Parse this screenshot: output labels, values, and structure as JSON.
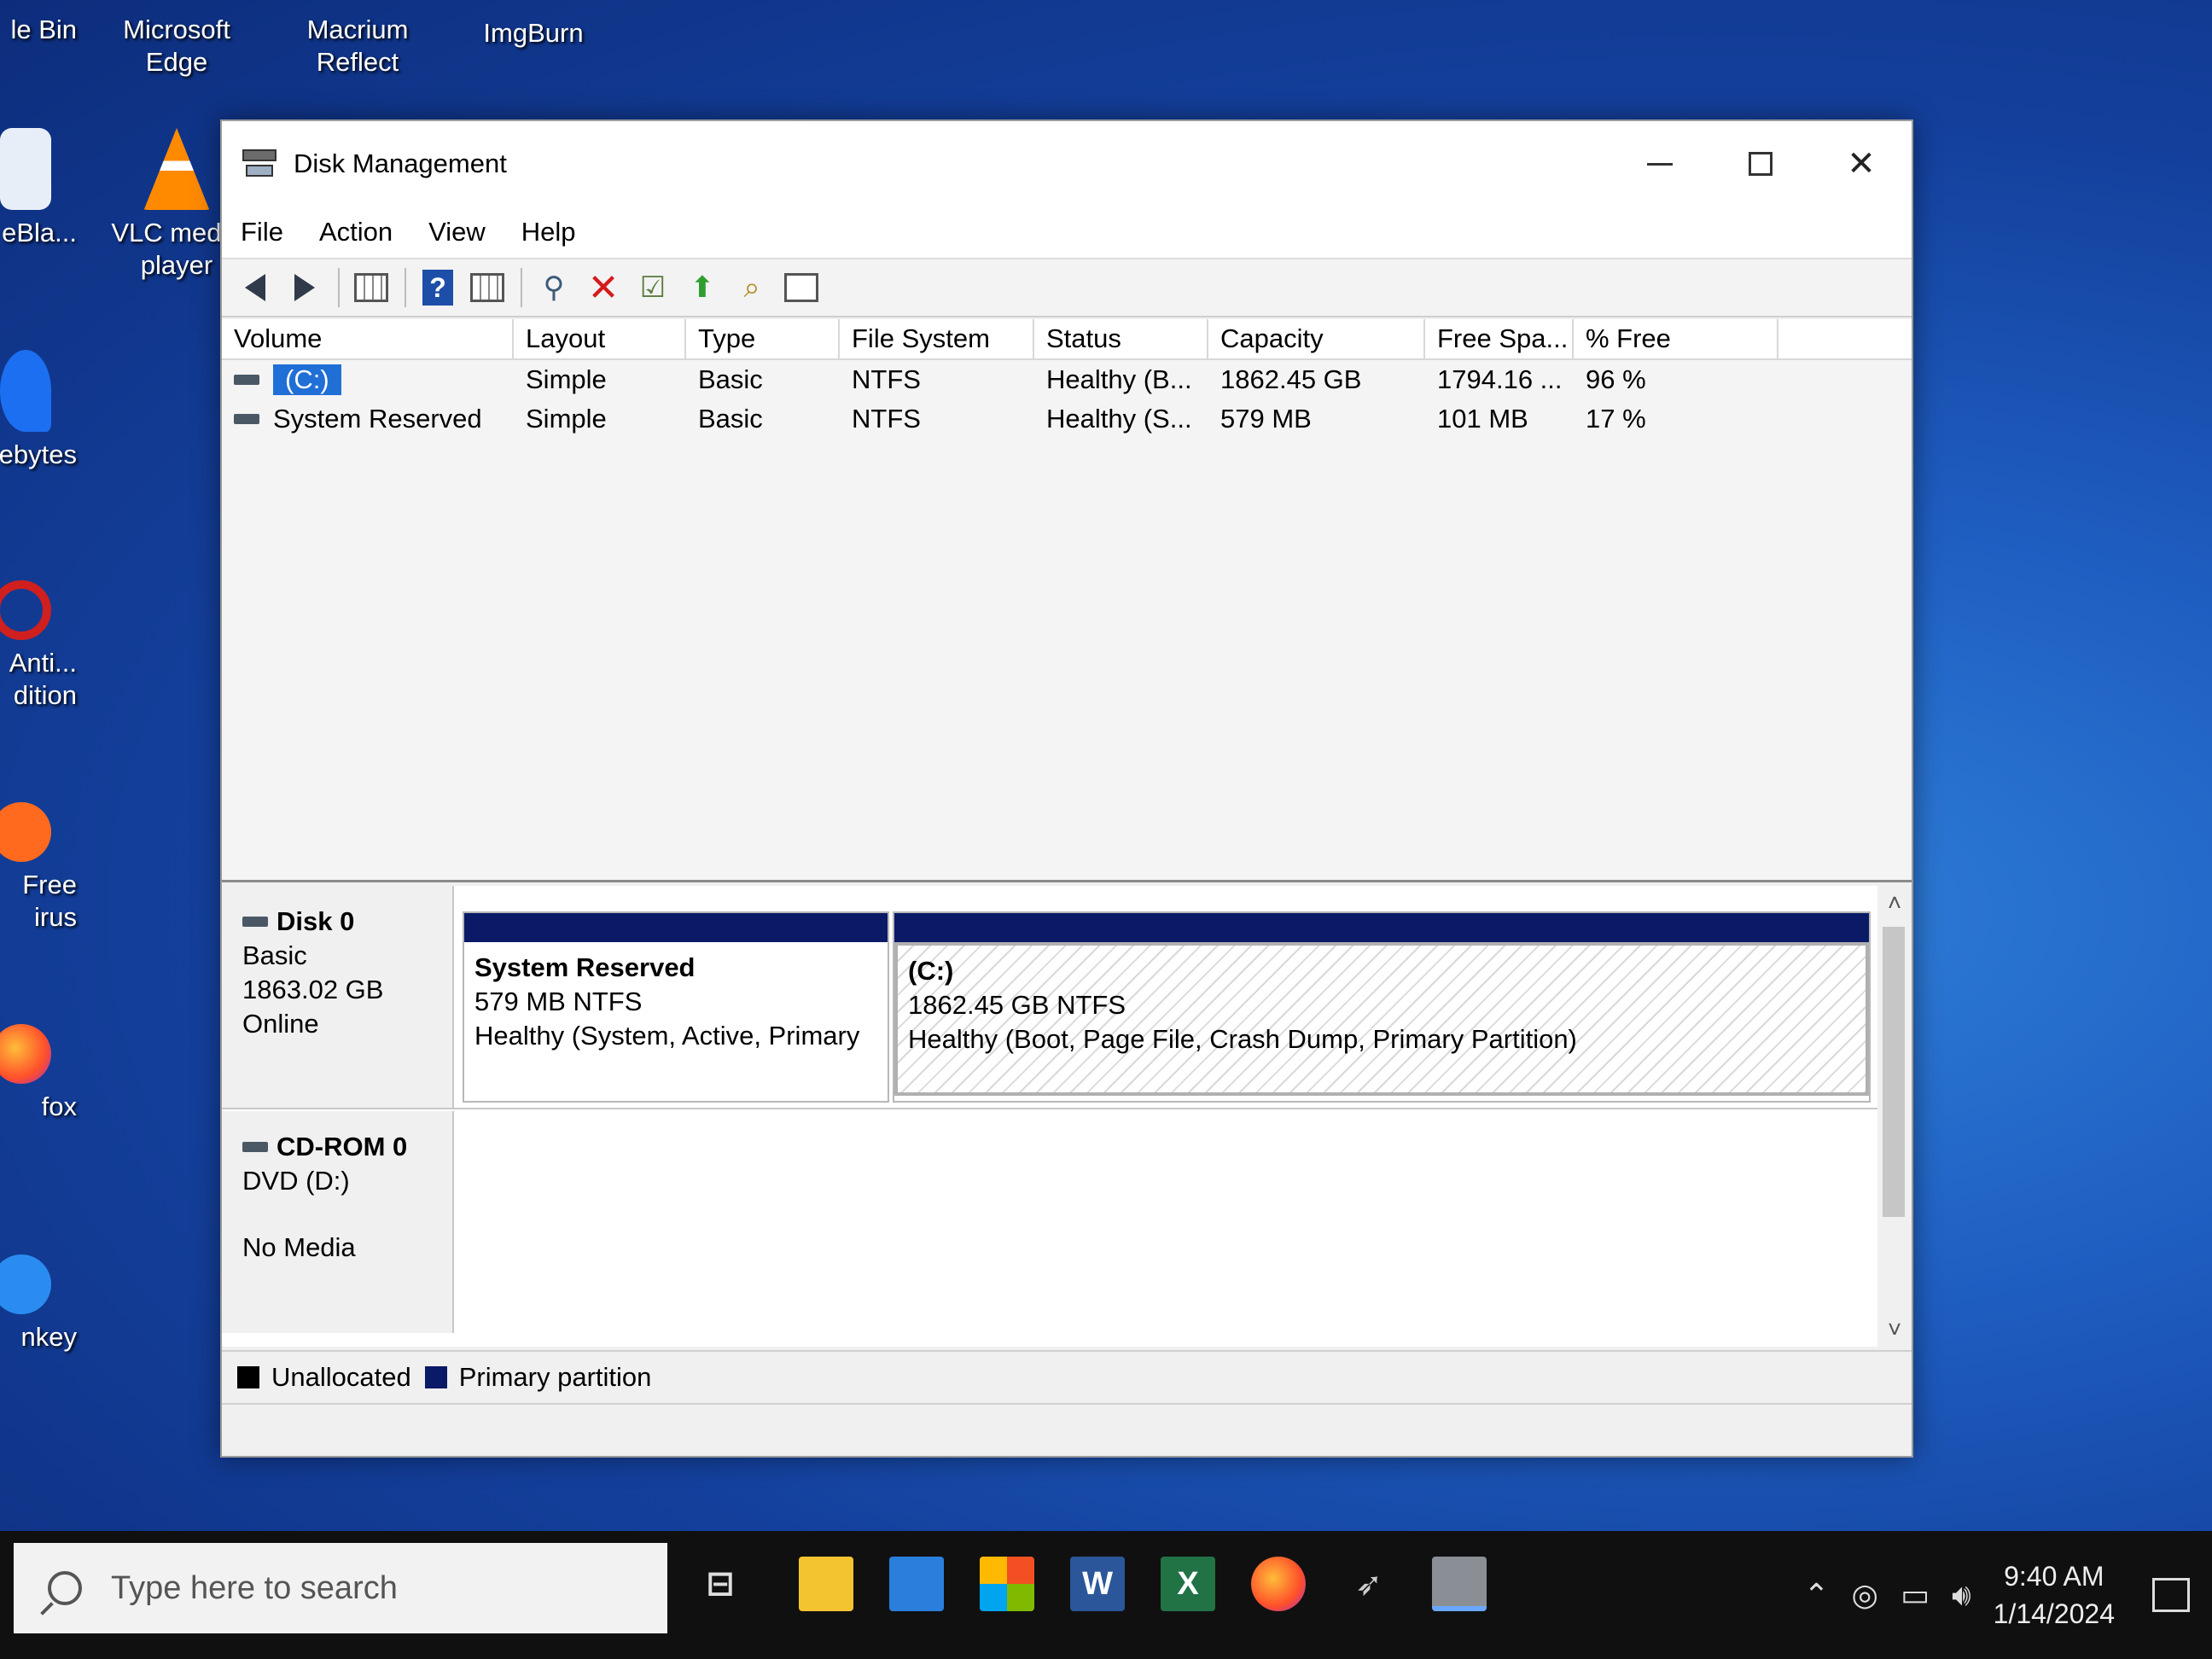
{
  "desktop": {
    "icons": [
      {
        "label": "le Bin"
      },
      {
        "label": "Microsoft Edge"
      },
      {
        "label": "Macrium Reflect"
      },
      {
        "label": "ImgBurn"
      },
      {
        "label": "eBla..."
      },
      {
        "label": "VLC media player"
      },
      {
        "label": "ebytes"
      },
      {
        "label": "Anti... dition"
      },
      {
        "label": "Free irus"
      },
      {
        "label": "fox"
      },
      {
        "label": "nkey"
      }
    ]
  },
  "window": {
    "title": "Disk Management",
    "controls": {
      "minimize": "–",
      "maximize": "☐",
      "close": "✕"
    }
  },
  "menu": [
    "File",
    "Action",
    "View",
    "Help"
  ],
  "toolbar": {
    "buttons": [
      "back-icon",
      "forward-icon",
      "console-tree-icon",
      "help-icon",
      "properties-icon",
      "connect-icon",
      "delete-icon",
      "check-icon",
      "up-icon",
      "search-icon",
      "view-icon"
    ]
  },
  "volumes": {
    "columns": [
      "Volume",
      "Layout",
      "Type",
      "File System",
      "Status",
      "Capacity",
      "Free Spa...",
      "% Free"
    ],
    "rows": [
      {
        "volume": "(C:)",
        "layout": "Simple",
        "type": "Basic",
        "fs": "NTFS",
        "status": "Healthy (B...",
        "capacity": "1862.45 GB",
        "free": "1794.16 ...",
        "pct": "96 %"
      },
      {
        "volume": "System Reserved",
        "layout": "Simple",
        "type": "Basic",
        "fs": "NTFS",
        "status": "Healthy (S...",
        "capacity": "579 MB",
        "free": "101 MB",
        "pct": "17 %"
      }
    ]
  },
  "disks": [
    {
      "name": "Disk 0",
      "type": "Basic",
      "size": "1863.02 GB",
      "state": "Online",
      "partitions": [
        {
          "title": "System Reserved",
          "size": "579 MB NTFS",
          "status": "Healthy (System, Active, Primary"
        },
        {
          "title": "(C:)",
          "size": "1862.45 GB NTFS",
          "status": "Healthy (Boot, Page File, Crash Dump, Primary Partition)"
        }
      ]
    },
    {
      "name": "CD-ROM 0",
      "type": "DVD (D:)",
      "state": "No Media"
    }
  ],
  "legend": [
    {
      "label": "Unallocated",
      "color": "#000000"
    },
    {
      "label": "Primary partition",
      "color": "#0a1a66"
    }
  ],
  "taskbar": {
    "search_placeholder": "Type here to search",
    "time": "9:40 AM",
    "date": "1/14/2024"
  },
  "colors": {
    "accent": "#1f6fd6",
    "partition_bar": "#0a1a66"
  }
}
